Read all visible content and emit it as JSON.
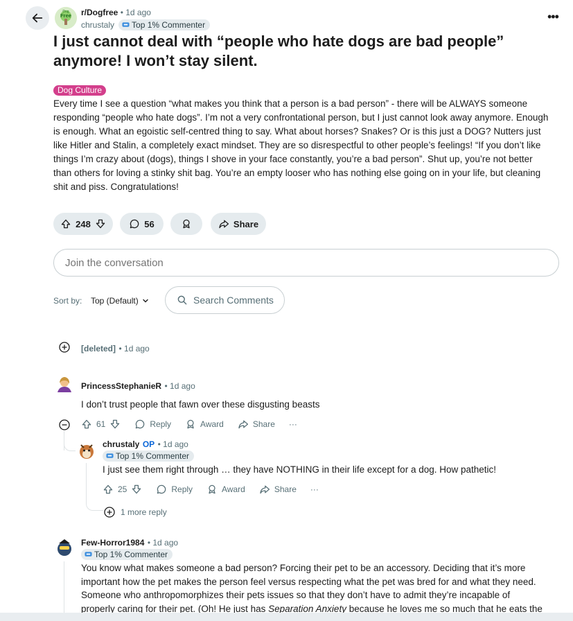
{
  "post": {
    "subreddit": "r/Dogfree",
    "sub_avatar_text": "Free",
    "sub_avatar_small": "Dog",
    "time": "1d ago",
    "author": "chrustaly",
    "author_flair": "Top 1% Commenter",
    "title": "I just cannot deal with “people who hate dogs are bad people” anymore! I won’t stay silent.",
    "flair": "Dog Culture",
    "body": "Every time I see a question “what makes you think that a person is a bad person” - there will be ALWAYS someone responding “people who hate dogs”. I’m not a very confrontational person, but I just cannot look away anymore. Enough is enough. What an egoistic self-centred thing to say. What about horses? Snakes? Or is this just a DOG? Nutters just like Hitler and Stalin, a completely exact mindset. They are so disrespectful to other people’s feelings! “If you don’t like things I’m crazy about (dogs), things I shove in your face constantly, you’re a bad person”. Shut up, you’re not better than others for loving a stinky shit bag. You’re an empty looser who has nothing else going on in your life, but cleaning shit and piss. Congratulations!",
    "votes": "248",
    "comments": "56",
    "share_label": "Share"
  },
  "conversation": {
    "placeholder": "Join the conversation"
  },
  "sort": {
    "label": "Sort by:",
    "value": "Top (Default)"
  },
  "search_comments": {
    "label": "Search Comments"
  },
  "comments": [
    {
      "author": "[deleted]",
      "time": "1d ago"
    },
    {
      "author": "PrincessStephanieR",
      "time": "1d ago",
      "text": "I don’t trust people that fawn over these disgusting beasts",
      "votes": "61",
      "reply": "Reply",
      "award": "Award",
      "share": "Share",
      "more": "···"
    },
    {
      "author": "chrustaly",
      "op": "OP",
      "time": "1d ago",
      "flair": "Top 1% Commenter",
      "text": "I just see them right through … they have NOTHING in their life except for a dog. How pathetic!",
      "votes": "25",
      "reply": "Reply",
      "award": "Award",
      "share": "Share",
      "more": "···",
      "more_replies": "1 more reply"
    },
    {
      "author": "Few-Horror1984",
      "time": "1d ago",
      "flair": "Top 1% Commenter",
      "text_lines": [
        "You know what makes someone a bad person? Forcing their pet to be an accessory. Deciding that it’s more",
        "important how the pet makes the person feel versus respecting what the pet was bred for and what they need.",
        "Someone who anthropomorphizes their pets issues so that they don’t have to admit they’re incapable of"
      ],
      "text_last_a": "properly caring for their pet. (Oh! He just has ",
      "text_last_em": "Separation Anxiety",
      "text_last_b": " because he loves me so much that he eats the"
    }
  ],
  "colors": {
    "flair_bg": "#d33f8c",
    "op": "#0a66d8",
    "pill_bg": "#e5ebee",
    "text": "#1c1c1c",
    "muted": "#576f76"
  }
}
